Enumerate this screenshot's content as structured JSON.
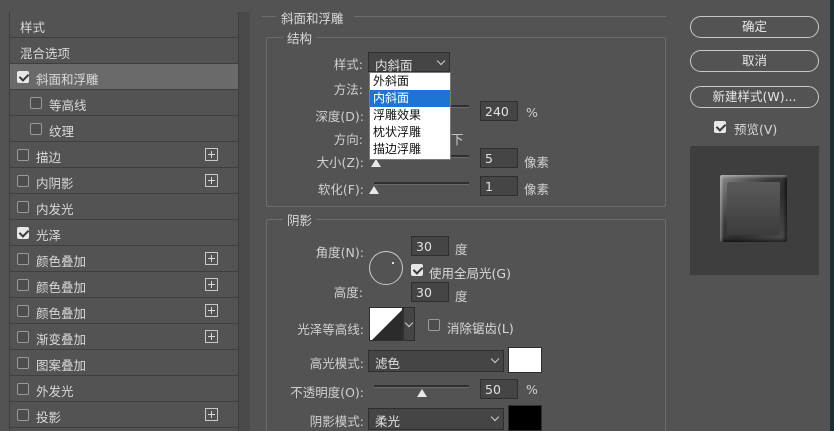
{
  "left_panel": {
    "items": [
      {
        "label": "样式",
        "checkbox": false,
        "checked": false,
        "plus": false,
        "selected": false,
        "indent": 0
      },
      {
        "label": "混合选项",
        "checkbox": false,
        "checked": false,
        "plus": false,
        "selected": false,
        "indent": 0
      },
      {
        "label": "斜面和浮雕",
        "checkbox": true,
        "checked": true,
        "plus": false,
        "selected": true,
        "indent": 0
      },
      {
        "label": "等高线",
        "checkbox": true,
        "checked": false,
        "plus": false,
        "selected": false,
        "indent": 1
      },
      {
        "label": "纹理",
        "checkbox": true,
        "checked": false,
        "plus": false,
        "selected": false,
        "indent": 1
      },
      {
        "label": "描边",
        "checkbox": true,
        "checked": false,
        "plus": true,
        "selected": false,
        "indent": 0
      },
      {
        "label": "内阴影",
        "checkbox": true,
        "checked": false,
        "plus": true,
        "selected": false,
        "indent": 0
      },
      {
        "label": "内发光",
        "checkbox": true,
        "checked": false,
        "plus": false,
        "selected": false,
        "indent": 0
      },
      {
        "label": "光泽",
        "checkbox": true,
        "checked": true,
        "plus": false,
        "selected": false,
        "indent": 0
      },
      {
        "label": "颜色叠加",
        "checkbox": true,
        "checked": false,
        "plus": true,
        "selected": false,
        "indent": 0
      },
      {
        "label": "颜色叠加",
        "checkbox": true,
        "checked": false,
        "plus": true,
        "selected": false,
        "indent": 0
      },
      {
        "label": "颜色叠加",
        "checkbox": true,
        "checked": false,
        "plus": true,
        "selected": false,
        "indent": 0
      },
      {
        "label": "渐变叠加",
        "checkbox": true,
        "checked": false,
        "plus": true,
        "selected": false,
        "indent": 0
      },
      {
        "label": "图案叠加",
        "checkbox": true,
        "checked": false,
        "plus": false,
        "selected": false,
        "indent": 0
      },
      {
        "label": "外发光",
        "checkbox": true,
        "checked": false,
        "plus": false,
        "selected": false,
        "indent": 0
      },
      {
        "label": "投影",
        "checkbox": true,
        "checked": false,
        "plus": true,
        "selected": false,
        "indent": 0
      }
    ]
  },
  "bevel": {
    "section_title": "斜面和浮雕",
    "structure": {
      "title": "结构",
      "style_label": "样式:",
      "style_value": "内斜面",
      "method_label": "方法:",
      "depth_label": "深度(D):",
      "depth_value": "240",
      "depth_unit": "%",
      "depth_slider_fraction": 0.24,
      "direction_label": "方向:",
      "direction_partial": "下",
      "size_label": "大小(Z):",
      "size_value": "5",
      "size_unit": "像素",
      "size_slider_fraction": 0.02,
      "soften_label": "软化(F):",
      "soften_value": "1",
      "soften_unit": "像素",
      "soften_slider_fraction": 0.0,
      "style_dropdown": {
        "options": [
          "外斜面",
          "内斜面",
          "浮雕效果",
          "枕状浮雕",
          "描边浮雕"
        ],
        "highlighted_index": 1
      }
    },
    "shading": {
      "title": "阴影",
      "angle_label": "角度(N):",
      "angle_value": "30",
      "angle_unit": "度",
      "global_light_label": "使用全局光(G)",
      "global_light_checked": true,
      "altitude_label": "高度:",
      "altitude_value": "30",
      "altitude_unit": "度",
      "gloss_contour_label": "光泽等高线:",
      "antialias_label": "消除锯齿(L)",
      "antialias_checked": false,
      "highlight_mode_label": "高光模式:",
      "highlight_mode_value": "滤色",
      "highlight_color": "#ffffff",
      "opacity_label": "不透明度(O):",
      "opacity_value": "50",
      "opacity_unit": "%",
      "opacity_slider_fraction": 0.5,
      "shadow_mode_label": "阴影模式:",
      "shadow_mode_value": "柔光",
      "shadow_color": "#000000"
    }
  },
  "right_panel": {
    "ok_label": "确定",
    "cancel_label": "取消",
    "new_style_label": "新建样式(W)...",
    "preview_label": "预览(V)",
    "preview_checked": true
  },
  "colors": {
    "panel_bg": "#535353",
    "selected_row": "#6a6a6a",
    "dropdown_highlight": "#1e74d3"
  }
}
